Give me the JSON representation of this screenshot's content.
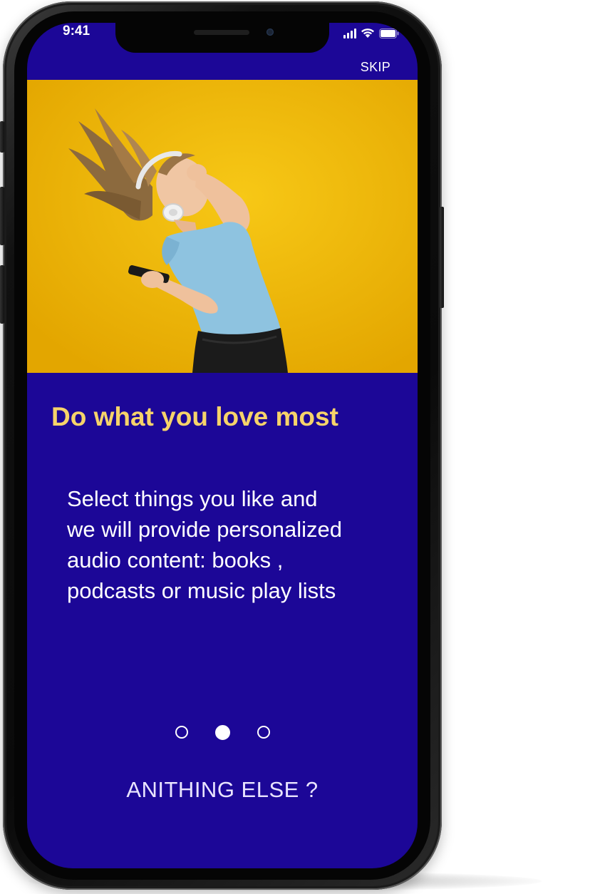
{
  "status_bar": {
    "time": "9:41",
    "icons": [
      "signal-icon",
      "wifi-icon",
      "battery-icon"
    ]
  },
  "header": {
    "skip_label": "SKIP"
  },
  "hero": {
    "image": "woman-with-headphones-dancing-photo",
    "background_color": "#efb800"
  },
  "content": {
    "title": "Do what you love most",
    "description_lines": [
      "Select things you like and",
      "we will provide personalized",
      "audio content: books ,",
      "podcasts or music play lists"
    ]
  },
  "pager": {
    "total_pages": 3,
    "active_page": 2
  },
  "footer": {
    "cta_label": "ANITHING ELSE ?"
  },
  "theme": {
    "screen_background": "#1c0797",
    "title_color": "#f6d36a",
    "text_color": "#ffffff"
  }
}
